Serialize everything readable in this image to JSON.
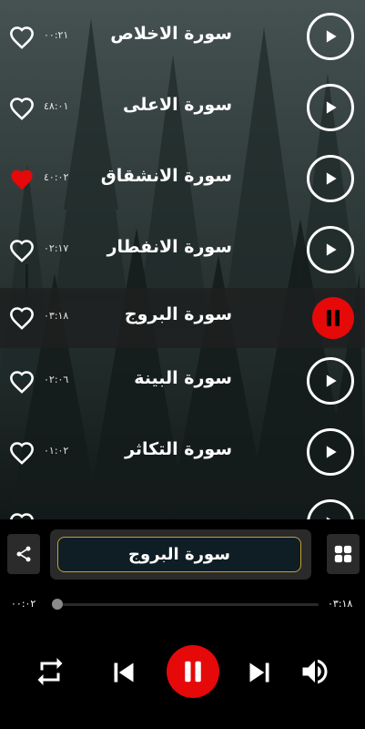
{
  "playlist": [
    {
      "title": "سورة الاخلاص",
      "duration": "۰۰:۲۱",
      "favorited": false,
      "state": "play"
    },
    {
      "title": "سورة الاعلى",
      "duration": "۰۱:٤۸",
      "favorited": false,
      "state": "play"
    },
    {
      "title": "سورة الانشقاق",
      "duration": "۰۲:٤۰",
      "favorited": true,
      "state": "play"
    },
    {
      "title": "سورة الانفطار",
      "duration": "۰۲:۱۷",
      "favorited": false,
      "state": "play"
    },
    {
      "title": "سورة البروج",
      "duration": "۰۳:۱۸",
      "favorited": false,
      "state": "pause"
    },
    {
      "title": "سورة البينة",
      "duration": "۰۲:۰٦",
      "favorited": false,
      "state": "play"
    },
    {
      "title": "سورة التكاثر",
      "duration": "۰۱:۰۲",
      "favorited": false,
      "state": "play"
    },
    {
      "title": "",
      "duration": "",
      "favorited": false,
      "state": "play"
    }
  ],
  "player": {
    "now_playing": "سورة البروج",
    "elapsed": "۰۰:۰۲",
    "total": "۰۳:۱۸",
    "progress": 0.01
  },
  "colors": {
    "accent_red": "#e50909",
    "gold_border": "#c8a032",
    "player_bg": "#000000"
  },
  "icons": {
    "share": "share-icon",
    "grid": "grid-icon",
    "repeat": "repeat-icon",
    "previous": "skip-previous-icon",
    "pause": "pause-icon",
    "next": "skip-next-icon",
    "volume": "volume-icon",
    "heart": "heart-icon",
    "play": "play-icon"
  }
}
